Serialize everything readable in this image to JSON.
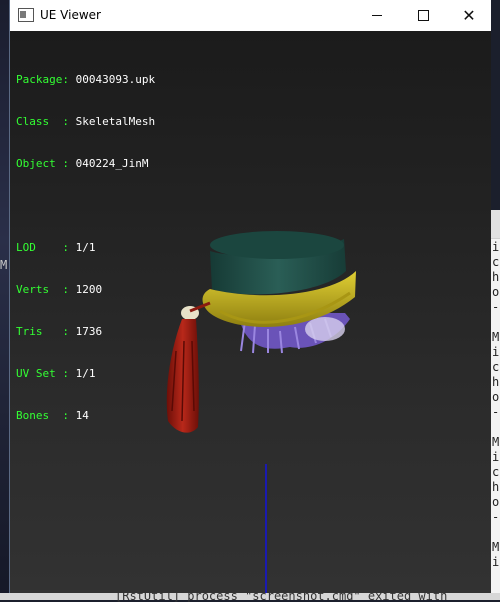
{
  "window": {
    "title": "UE Viewer"
  },
  "info": [
    {
      "key": "Package",
      "value": "00043093.upk"
    },
    {
      "key": "Class  ",
      "value": "SkeletalMesh"
    },
    {
      "key": "Object ",
      "value": "040224_JinM"
    }
  ],
  "stats": [
    {
      "key": "LOD    ",
      "value": "1/1"
    },
    {
      "key": "Verts  ",
      "value": "1200"
    },
    {
      "key": "Tris   ",
      "value": "1736"
    },
    {
      "key": "UV Set ",
      "value": "1/1"
    },
    {
      "key": "Bones  ",
      "value": "14"
    }
  ],
  "background": {
    "left_glyph": "M",
    "terminal_lines": [
      "i",
      "c",
      "h",
      "o",
      "-",
      "",
      "M",
      "i",
      "c",
      "h",
      "o",
      "-",
      "",
      "M",
      "i",
      "c",
      "h",
      "o",
      "-",
      "",
      "M",
      "i"
    ],
    "status_line": "[RstUtil] process \"screenshot.cmd\" exited with"
  },
  "colors": {
    "label_green": "#33ff33",
    "value_white": "#ffffff",
    "axis_blue": "#1a1ab0",
    "hat_teal": "#1e4a44",
    "band_yellow": "#c9b81e",
    "tassel_red": "#a51f12",
    "hair_purple": "#7c63c9"
  }
}
